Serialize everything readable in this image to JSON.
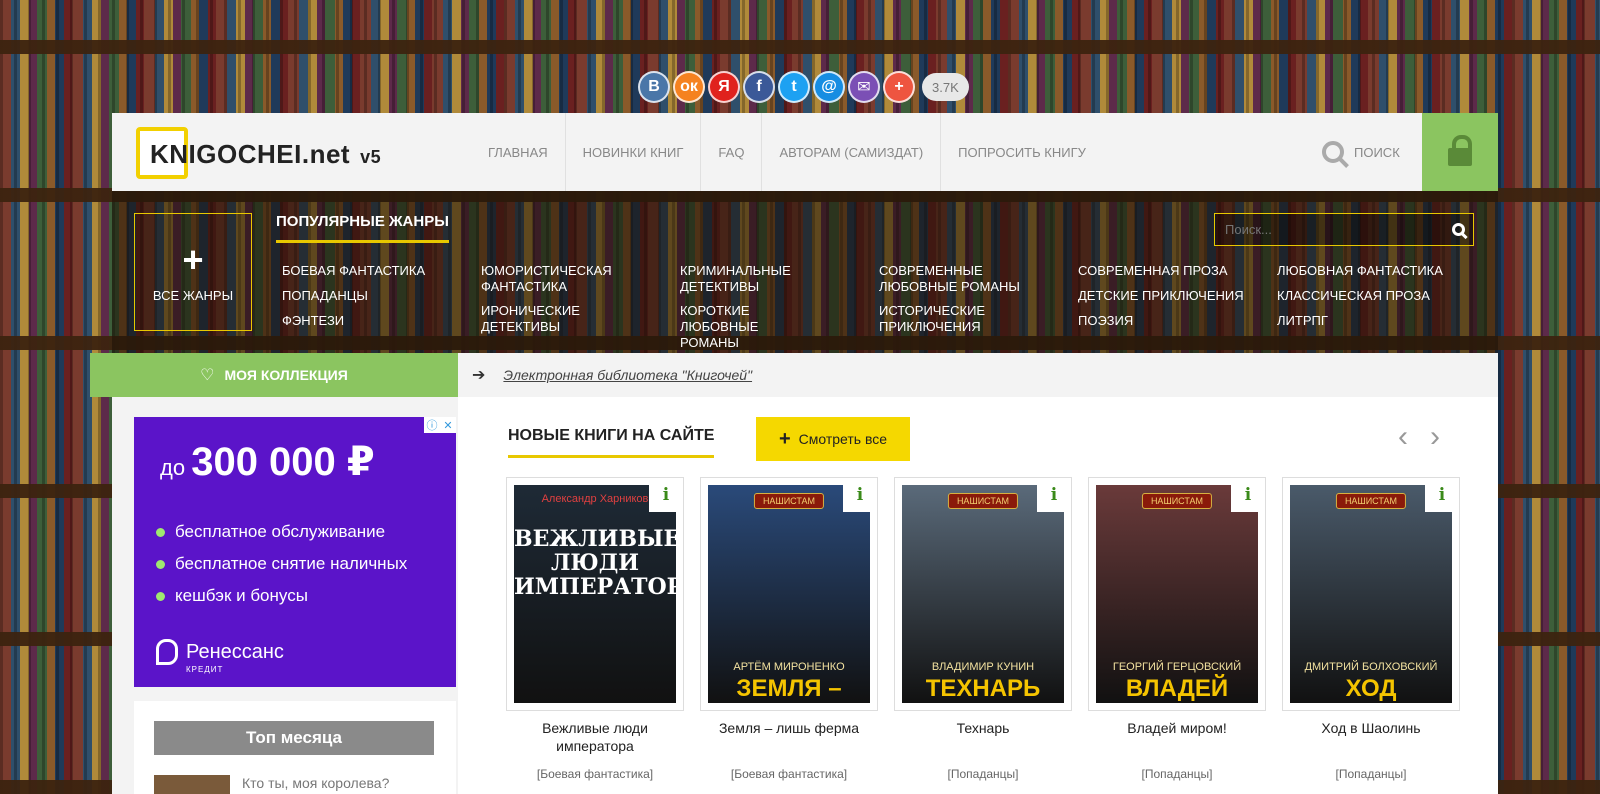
{
  "social": {
    "buttons": [
      {
        "label": "В",
        "color": "#4a76a8"
      },
      {
        "label": "ок",
        "color": "#f58220"
      },
      {
        "label": "Я",
        "color": "#e0221d"
      },
      {
        "label": "f",
        "color": "#3b5998"
      },
      {
        "label": "t",
        "color": "#1da1f2"
      },
      {
        "label": "@",
        "color": "#168de2"
      },
      {
        "label": "✉",
        "color": "#7b4fb5"
      },
      {
        "label": "+",
        "color": "#ee5540"
      }
    ],
    "count": "3.7K"
  },
  "header": {
    "logo_text": "KNIGOCHEI.net",
    "version": "v5",
    "nav": [
      "ГЛАВНАЯ",
      "НОВИНКИ КНИГ",
      "FAQ",
      "АВТОРАМ (САМИЗДАТ)",
      "ПОПРОСИТЬ КНИГУ"
    ],
    "search_label": "ПОИСК"
  },
  "genres": {
    "all_label": "ВСЕ ЖАНРЫ",
    "popular_title": "ПОПУЛЯРНЫЕ ЖАНРЫ",
    "search_placeholder": "Поиск...",
    "columns": [
      [
        "БОЕВАЯ ФАНТАСТИКА",
        "ПОПАДАНЦЫ",
        "ФЭНТЕЗИ"
      ],
      [
        "ЮМОРИСТИЧЕСКАЯ ФАНТАСТИКА",
        "ИРОНИЧЕСКИЕ ДЕТЕКТИВЫ"
      ],
      [
        "КРИМИНАЛЬНЫЕ ДЕТЕКТИВЫ",
        "КОРОТКИЕ ЛЮБОВНЫЕ РОМАНЫ"
      ],
      [
        "СОВРЕМЕННЫЕ ЛЮБОВНЫЕ РОМАНЫ",
        "ИСТОРИЧЕСКИЕ ПРИКЛЮЧЕНИЯ"
      ],
      [
        "СОВРЕМЕННАЯ ПРОЗА",
        "ДЕТСКИЕ ПРИКЛЮЧЕНИЯ",
        "ПОЭЗИЯ"
      ],
      [
        "ЛЮБОВНАЯ ФАНТАСТИКА",
        "КЛАССИЧЕСКАЯ ПРОЗА",
        "ЛИТРПГ"
      ]
    ]
  },
  "collection_label": "МОЯ КОЛЛЕКЦИЯ",
  "breadcrumb": "Электронная библиотека \"Книгочей\"",
  "ad": {
    "prefix": "до",
    "amount": "300 000 ₽",
    "items": [
      "бесплатное обслуживание",
      "бесплатное снятие наличных",
      "кешбэк и бонусы"
    ],
    "brand": "Ренессанс",
    "brand_sub": "КРЕДИТ"
  },
  "sidebar": {
    "top_month": "Топ месяца",
    "first_item": "Кто ты, моя королева?"
  },
  "new_books": {
    "title": "НОВЫЕ КНИГИ НА САЙТЕ",
    "see_all": "Смотреть все",
    "books": [
      {
        "name": "Вежливые люди императора",
        "genre": "[Боевая фантастика]",
        "cover_author": "Александр Харников",
        "cover_title": "ВЕЖЛИВЫЕ ЛЮДИ ИМПЕРАТОРА",
        "badge": "",
        "bg": "#1e2a36"
      },
      {
        "name": "Земля – лишь ферма",
        "genre": "[Боевая фантастика]",
        "cover_author": "АРТЁМ МИРОНЕНКО",
        "cover_title": "ЗЕМЛЯ –",
        "badge": "НАШИСТАМ",
        "bg": "#2a4a7a"
      },
      {
        "name": "Технарь",
        "genre": "[Попаданцы]",
        "cover_author": "ВЛАДИМИР КУНИН",
        "cover_title": "ТЕХНАРЬ",
        "badge": "НАШИСТАМ",
        "bg": "#5a6a7a"
      },
      {
        "name": "Владей миром!",
        "genre": "[Попаданцы]",
        "cover_author": "ГЕОРГИЙ ГЕРЦОВСКИЙ",
        "cover_title": "ВЛАДЕЙ",
        "badge": "НАШИСТАМ",
        "bg": "#6a3a3a"
      },
      {
        "name": "Ход в Шаолинь",
        "genre": "[Попаданцы]",
        "cover_author": "ДМИТРИЙ БОЛХОВСКИЙ",
        "cover_title": "ХОД",
        "badge": "НАШИСТАМ",
        "bg": "#4a5a6a"
      }
    ]
  }
}
